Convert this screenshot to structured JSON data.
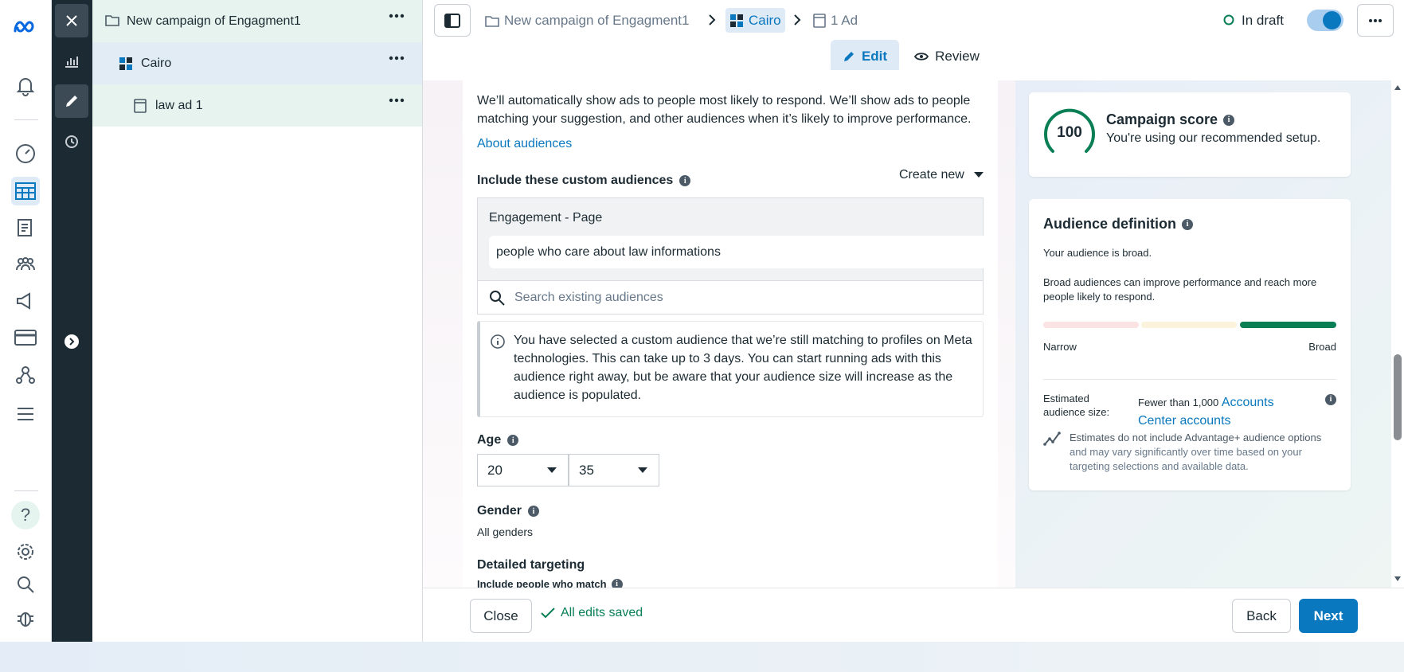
{
  "tree": {
    "campaign": "New campaign of Engagment1",
    "adset": "Cairo",
    "ad": "law ad 1"
  },
  "topbar": {
    "crumb_campaign": "New campaign of Engagment1",
    "crumb_adset": "Cairo",
    "crumb_ad": "1 Ad",
    "status": "In draft",
    "edit_tab": "Edit",
    "review_tab": "Review"
  },
  "form": {
    "audience_desc": "We’ll automatically show ads to people most likely to respond. We’ll show ads to people matching your suggestion, and other audiences when it’s likely to improve performance.",
    "about_link": "About audiences",
    "custom_label": "Include these custom audiences",
    "create_new": "Create new",
    "engagement_group": "Engagement - Page",
    "selected_audience": "people who care about law informations",
    "search_placeholder": "Search existing audiences",
    "notice": "You have selected a custom audience that we’re still matching to profiles on Meta technologies. This can take up to 3 days. You can start running ads with this audience right away, but be aware that your audience size will increase as the audience is populated.",
    "age_label": "Age",
    "age_min": "20",
    "age_max": "35",
    "gender_label": "Gender",
    "gender_value": "All genders",
    "detailed_label": "Detailed targeting",
    "detailed_sub": "Include people who match"
  },
  "score": {
    "value": "100",
    "title": "Campaign score",
    "desc": "You're using our recommended setup."
  },
  "audience_def": {
    "title": "Audience definition",
    "broad_line": "Your audience is broad.",
    "broad_desc": "Broad audiences can improve performance and reach more people likely to respond.",
    "narrow": "Narrow",
    "broad": "Broad",
    "size_label": "Estimated audience size:",
    "size_value": "Fewer than 1,000",
    "size_link": "Accounts Center accounts",
    "estimate_pre": "Estimates do not include Advantage+ audience options",
    "estimate_post": " and may vary significantly over time based on your targeting selections and available data."
  },
  "footer": {
    "close": "Close",
    "saved": "All edits saved",
    "back": "Back",
    "next": "Next"
  },
  "colors": {
    "accent": "#0a78be",
    "dark": "#1c2b33",
    "success": "#0a7f55"
  }
}
